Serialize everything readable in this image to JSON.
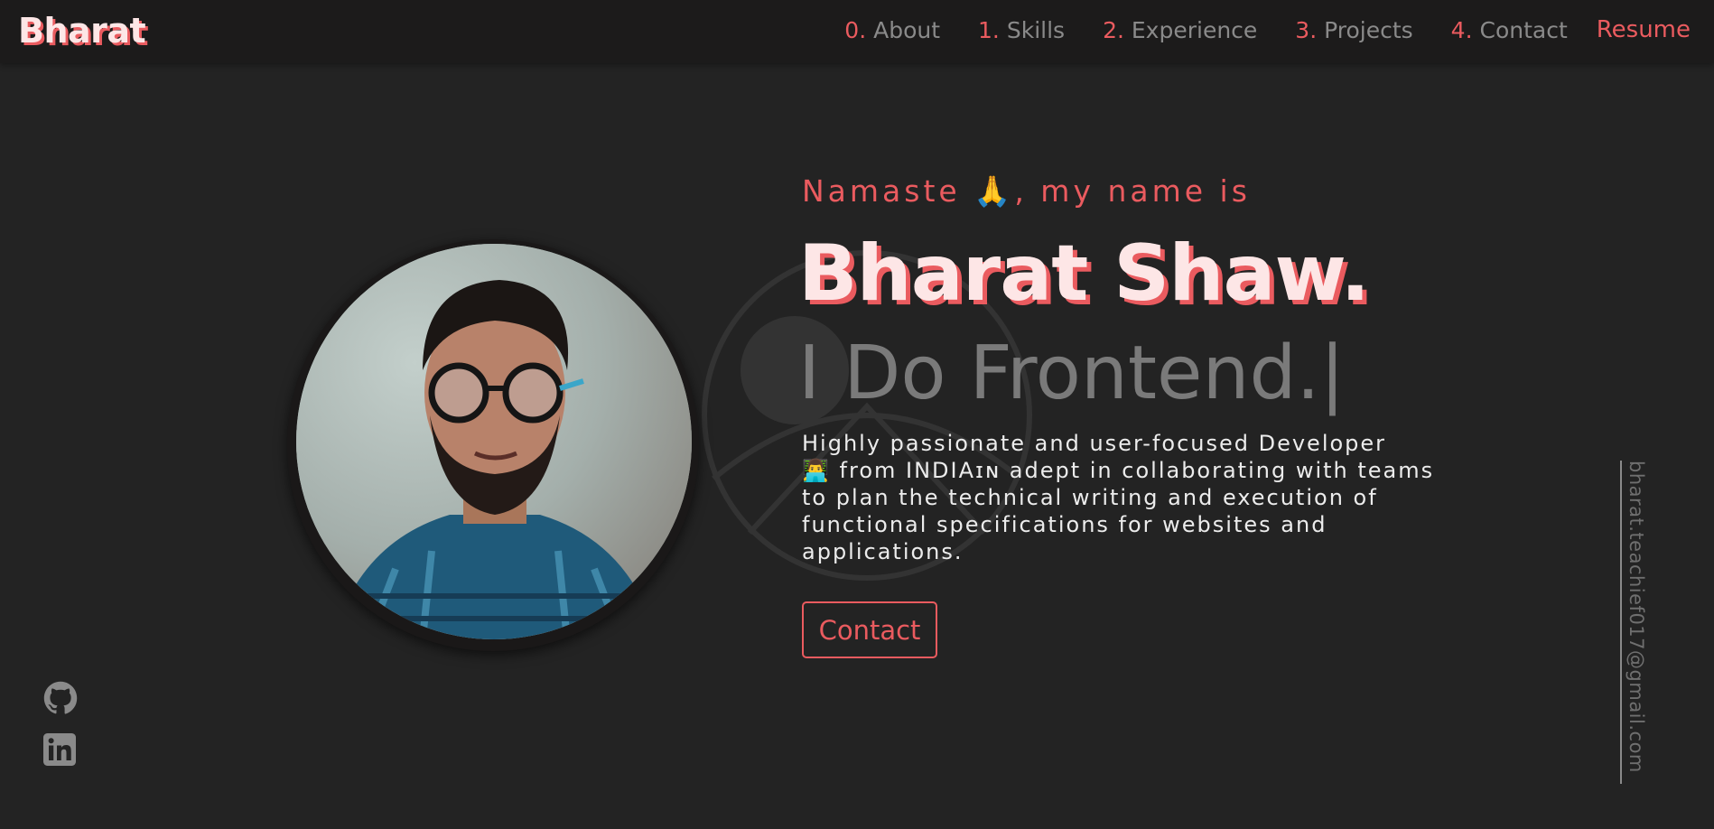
{
  "header": {
    "logo": "Bharat",
    "nav": [
      {
        "num": "0.",
        "label": "About"
      },
      {
        "num": "1.",
        "label": "Skills"
      },
      {
        "num": "2.",
        "label": "Experience"
      },
      {
        "num": "3.",
        "label": "Projects"
      },
      {
        "num": "4.",
        "label": "Contact"
      }
    ],
    "resume_label": "Resume"
  },
  "hero": {
    "greeting_prefix": "Namaste",
    "greeting_emoji": "🙏",
    "greeting_suffix": ", my name is",
    "name": "Bharat Shaw.",
    "tagline": "I Do Frontend.|",
    "bio_line_1": "Highly passionate and user-focused Developer",
    "bio_emoji": "👨‍💻",
    "bio_rest": "from INDIAɪɴ adept in collaborating with teams to plan the technical writing and execution of functional specifications for websites and applications.",
    "contact_label": "Contact"
  },
  "social": {
    "icons": [
      "github-icon",
      "linkedin-icon"
    ]
  },
  "email": "bharat.teachief017@gmail.com",
  "colors": {
    "accent": "#ea5b5f",
    "background": "#232323",
    "header": "#1c1b1b",
    "muted": "#8a8a8a"
  }
}
